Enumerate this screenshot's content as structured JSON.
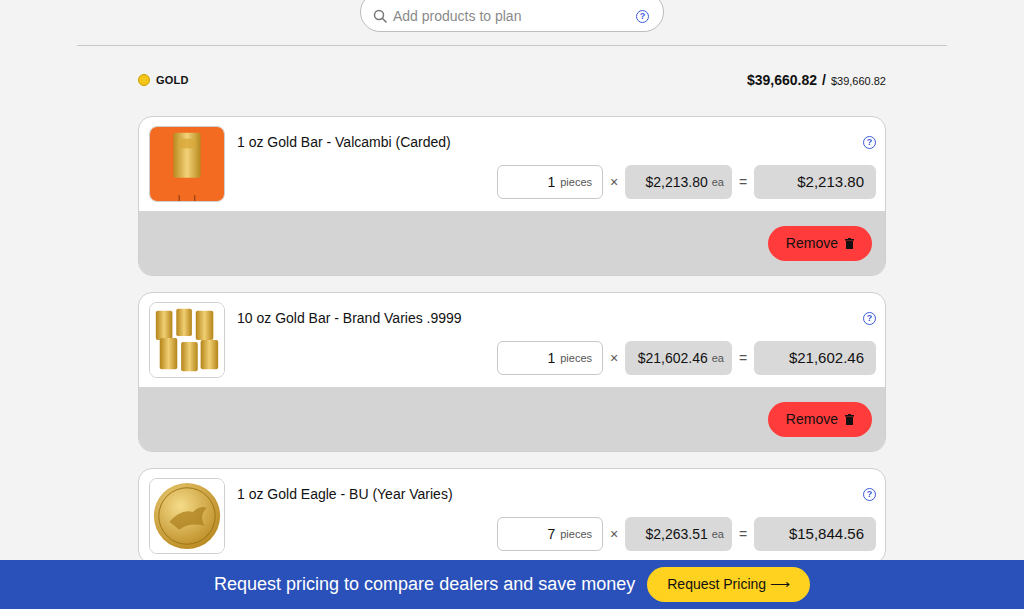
{
  "search": {
    "placeholder": "Add products to plan",
    "help": "?"
  },
  "metal": {
    "name": "GOLD",
    "total": "$39,660.82",
    "separator": "/",
    "target": "$39,660.82"
  },
  "products": [
    {
      "kind": "carded-bar",
      "title": "1 oz Gold Bar - Valcambi (Carded)",
      "help": "?",
      "quantity": "1",
      "unit": "pieces",
      "times": "×",
      "price": "$2,213.80",
      "price_unit": "ea",
      "equals": "=",
      "total": "$2,213.80",
      "remove": "Remove"
    },
    {
      "kind": "multi-bar",
      "title": "10 oz Gold Bar - Brand Varies .9999",
      "help": "?",
      "quantity": "1",
      "unit": "pieces",
      "times": "×",
      "price": "$21,602.46",
      "price_unit": "ea",
      "equals": "=",
      "total": "$21,602.46",
      "remove": "Remove"
    },
    {
      "kind": "coin",
      "title": "1 oz Gold Eagle - BU (Year Varies)",
      "help": "?",
      "quantity": "7",
      "unit": "pieces",
      "times": "×",
      "price": "$2,263.51",
      "price_unit": "ea",
      "equals": "=",
      "total": "$15,844.56"
    }
  ],
  "footer": {
    "message": "Request pricing to compare dealers and save money",
    "button": "Request Pricing ⟶"
  }
}
